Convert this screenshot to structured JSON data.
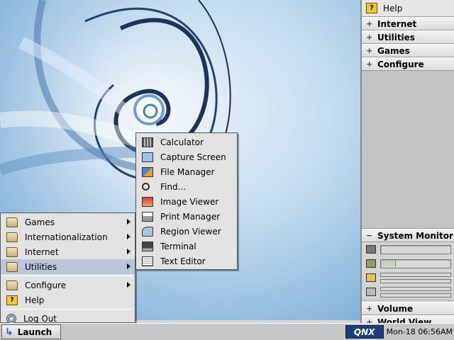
{
  "launch_menu": {
    "items": [
      {
        "label": "Games",
        "icon": "folder-icon",
        "submenu": true
      },
      {
        "label": "Internationalization",
        "icon": "folder-icon",
        "submenu": true
      },
      {
        "label": "Internet",
        "icon": "folder-icon",
        "submenu": true
      },
      {
        "label": "Utilities",
        "icon": "folder-icon",
        "submenu": true,
        "selected": true
      },
      {
        "label": "Configure",
        "icon": "folder-icon",
        "submenu": true
      },
      {
        "label": "Help",
        "icon": "help-icon",
        "submenu": false
      },
      {
        "label": "Log Out",
        "icon": "logout-icon",
        "submenu": false
      }
    ]
  },
  "utilities_menu": {
    "items": [
      {
        "label": "Calculator",
        "icon": "calculator-icon"
      },
      {
        "label": "Capture Screen",
        "icon": "capture-screen-icon"
      },
      {
        "label": "File Manager",
        "icon": "file-manager-icon"
      },
      {
        "label": "Find...",
        "icon": "magnifier-icon"
      },
      {
        "label": "Image Viewer",
        "icon": "image-viewer-icon"
      },
      {
        "label": "Print Manager",
        "icon": "printer-icon"
      },
      {
        "label": "Region Viewer",
        "icon": "region-viewer-icon"
      },
      {
        "label": "Terminal",
        "icon": "terminal-icon"
      },
      {
        "label": "Text Editor",
        "icon": "text-editor-icon"
      }
    ]
  },
  "shelf": {
    "help_label": "Help",
    "groups_top": [
      "Internet",
      "Utilities",
      "Games",
      "Configure"
    ],
    "system_monitor_label": "System Monitor",
    "monitors": [
      {
        "icon": "cpu-icon",
        "level": 0.0
      },
      {
        "icon": "memory-icon",
        "level": 0.2
      },
      {
        "icon": "process-icon",
        "level": 0.0
      },
      {
        "icon": "disk-icon",
        "level": 0.0
      }
    ],
    "groups_bottom": [
      "Volume",
      "World View"
    ]
  },
  "taskbar": {
    "launch_label": "Launch",
    "logo_text": "QNX",
    "clock": "Mon-18 06:56AM"
  }
}
